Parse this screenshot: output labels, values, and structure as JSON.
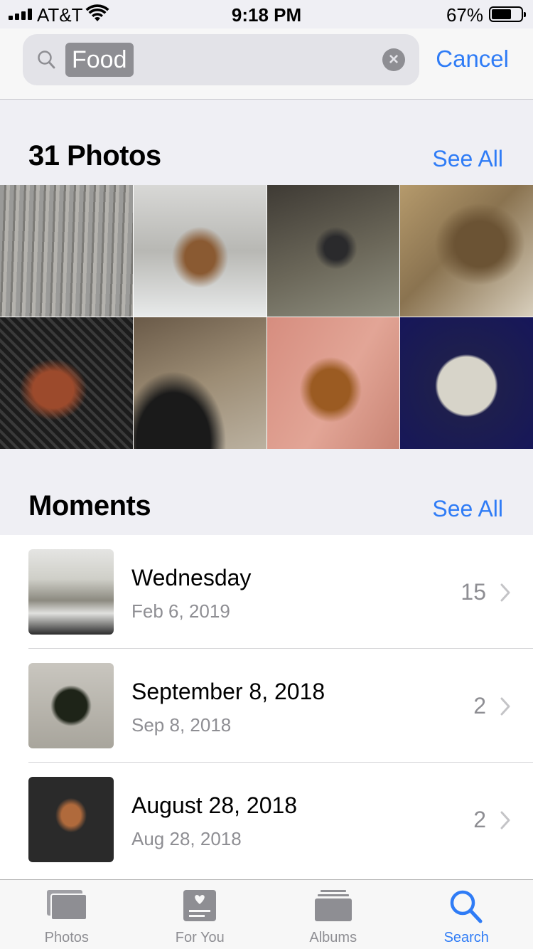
{
  "status_bar": {
    "carrier": "AT&T",
    "time": "9:18 PM",
    "battery_percent": "67%",
    "battery_level": 0.67,
    "signal_bars": 4
  },
  "search": {
    "query_token": "Food",
    "cancel_label": "Cancel",
    "icons": {
      "search": "search-icon",
      "clear": "clear-icon"
    }
  },
  "photos_section": {
    "title": "31 Photos",
    "see_all_label": "See All",
    "photos": [
      "photo-1",
      "photo-2",
      "photo-3",
      "photo-4",
      "photo-5",
      "photo-6",
      "photo-7",
      "photo-8"
    ]
  },
  "moments_section": {
    "title": "Moments",
    "see_all_label": "See All",
    "items": [
      {
        "title": "Wednesday",
        "date": "Feb 6, 2019",
        "count": "15"
      },
      {
        "title": "September 8, 2018",
        "date": "Sep 8, 2018",
        "count": "2"
      },
      {
        "title": "August 28, 2018",
        "date": "Aug 28, 2018",
        "count": "2"
      }
    ]
  },
  "tab_bar": {
    "tabs": [
      {
        "label": "Photos",
        "icon": "photos-icon"
      },
      {
        "label": "For You",
        "icon": "for-you-icon"
      },
      {
        "label": "Albums",
        "icon": "albums-icon"
      },
      {
        "label": "Search",
        "icon": "search-icon"
      }
    ],
    "active_tab": "Search"
  },
  "colors": {
    "accent": "#2f7cf6",
    "background": "#efeff4",
    "secondary_text": "#8e8e93"
  }
}
